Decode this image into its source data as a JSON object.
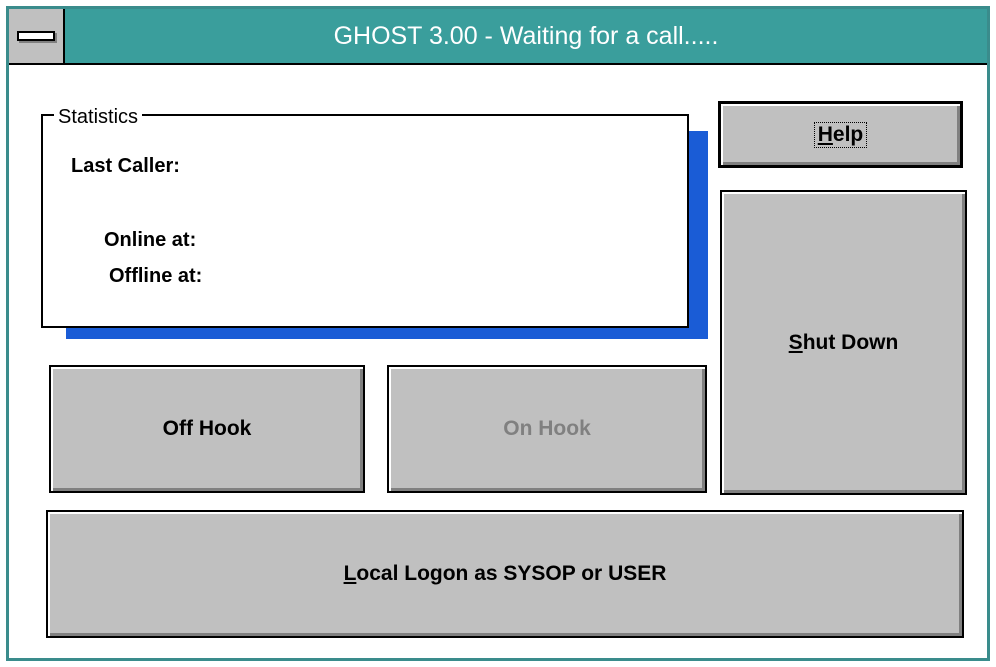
{
  "window": {
    "title": "GHOST 3.00 - Waiting for a call....."
  },
  "statistics": {
    "legend": "Statistics",
    "last_caller_label": "Last Caller:",
    "online_at_label": "Online at:",
    "offline_at_label": "Offline at:"
  },
  "buttons": {
    "help": {
      "mnemonic": "H",
      "rest": "elp"
    },
    "shut_down": {
      "mnemonic": "S",
      "rest": "hut Down"
    },
    "off_hook": "Off Hook",
    "on_hook": "On Hook",
    "local_logon": {
      "mnemonic": "L",
      "rest": "ocal Logon as SYSOP or USER"
    }
  },
  "colors": {
    "title_bar": "#3a9e9c",
    "stats_shadow": "#1a5cd6",
    "button_face": "#c0c0c0"
  }
}
